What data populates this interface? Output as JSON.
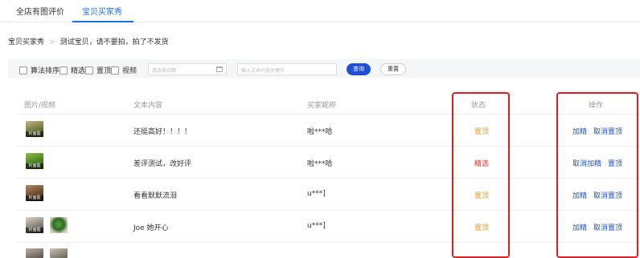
{
  "tabs": [
    {
      "label": "全店有图评价",
      "active": false
    },
    {
      "label": "宝贝买家秀",
      "active": true
    }
  ],
  "breadcrumb": {
    "root": "宝贝买家秀",
    "separator": ">",
    "item": "测试宝贝，请不要拍，拍了不发货"
  },
  "filters": {
    "checkboxes": [
      "算法排序",
      "精选",
      "置顶",
      "视频"
    ],
    "date_placeholder": "请选择日期",
    "keyword_placeholder": "输入文本内容关键字",
    "search_label": "查询",
    "reset_label": "重置"
  },
  "table": {
    "headers": {
      "media": "图片/视频",
      "text": "文本内容",
      "nickname": "买家昵称",
      "status": "状态",
      "actions": "操作"
    },
    "thumb_caption": "封面图",
    "rows": [
      {
        "text": "还挺高好！！！！",
        "nickname": "啦***哈",
        "status": "置顶",
        "status_color": "#f59a23",
        "actions": [
          "加精",
          "取消置顶"
        ]
      },
      {
        "text": "差评测试，改好评",
        "nickname": "啦***哈",
        "status": "精选",
        "status_color": "#e8331f",
        "actions": [
          "取消加精",
          "置顶"
        ]
      },
      {
        "text": "看看默默流泪",
        "nickname": "u***]",
        "status": "置顶",
        "status_color": "#f59a23",
        "actions": [
          "加精",
          "取消置顶"
        ]
      },
      {
        "text": "Joe 她开心",
        "nickname": "u***]",
        "status": "置顶",
        "status_color": "#f59a23",
        "actions": [
          "加精",
          "取消置顶"
        ]
      }
    ]
  },
  "colors": {
    "accent": "#1f4fd6",
    "tab_active": "#1f6fe6",
    "highlight_box": "#d81e28"
  }
}
